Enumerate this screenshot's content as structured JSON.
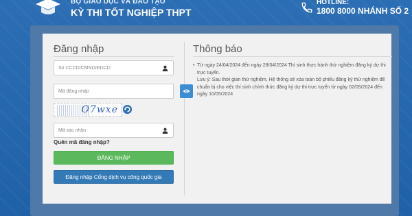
{
  "header": {
    "ministry": "BỘ GIÁO DỤC VÀ ĐÀO TẠO",
    "exam_title": "KỲ THI TỐT NGHIỆP THPT",
    "hotline_label": "HOTLINE:",
    "hotline_value": "1800 8000 NHÁNH SỐ 2"
  },
  "login": {
    "title": "Đăng nhập",
    "id_placeholder": "Số CCCD/CMND/ĐDCD",
    "password_placeholder": "Mã đăng nhập",
    "captcha_text": "O7wxe",
    "captcha_placeholder": "Mã xác nhận",
    "forgot_label": "Quên mã đăng nhập?",
    "login_button": "ĐĂNG NHẬP",
    "portal_button": "Đăng nhập Cổng dịch vụ công quốc gia"
  },
  "notice": {
    "title": "Thông báo",
    "item": "Từ ngày 24/04/2024 đến ngày 28/04/2024 Thí sinh thực hành thử nghiệm đăng ký dự thi trực tuyến.",
    "note": "Lưu ý: Sau thời gian thử nghiệm, Hệ thống sẽ xóa toàn bộ phiếu đăng ký thử nghiệm để chuẩn bị cho việc thí sinh chính thức đăng ký dự thi trực tuyến từ ngày 02/05/2024 đến ngày 10/05/2024"
  },
  "icons": {
    "logo": "ministry-logo",
    "phone": "phone-icon",
    "user": "user-icon",
    "eye": "eye-icon",
    "refresh": "refresh-icon"
  },
  "colors": {
    "background": "#2166b0",
    "login_button": "#5cb85c",
    "portal_button": "#337ab7",
    "eye_button": "#3b8ed4"
  }
}
